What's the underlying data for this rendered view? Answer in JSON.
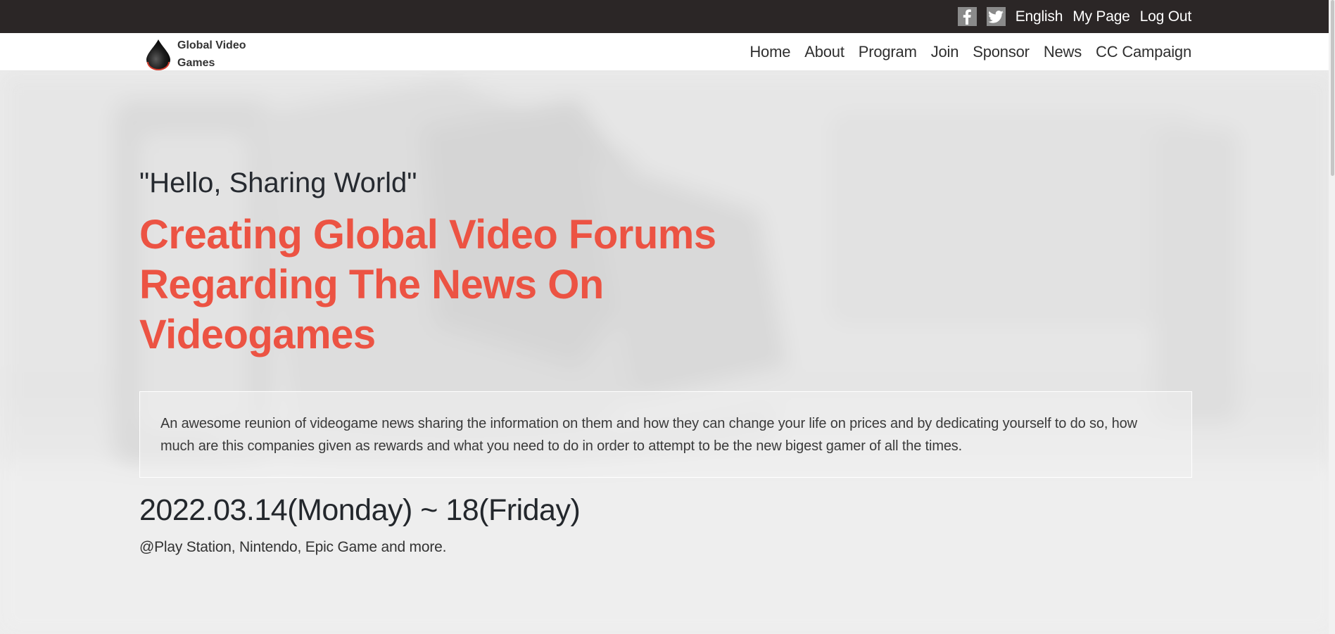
{
  "topbar": {
    "icons": [
      "facebook-icon",
      "twitter-icon"
    ],
    "language": "English",
    "my_page": "My Page",
    "logout": "Log Out"
  },
  "nav": {
    "logo_line1": "Global Video",
    "logo_line2": "Games",
    "links": [
      "Home",
      "About",
      "Program",
      "Join",
      "Sponsor",
      "News",
      "CC Campaign"
    ]
  },
  "hero": {
    "tagline": "\"Hello, Sharing World\"",
    "headline_line1": "Creating Global Video Forums",
    "headline_line2": "Regarding The News On",
    "headline_line3": "Videogames",
    "description": "An awesome reunion of videogame news sharing the information on them and how they can change your life on prices and by dedicating yourself to do so, how much are this companies given as rewards and what you need to do in order to attempt to be the new bigest gamer of all the times.",
    "date": "2022.03.14(Monday) ~ 18(Friday)",
    "venue": "@Play Station, Nintendo, Epic Game and more."
  },
  "colors": {
    "topbar_bg": "#2b2626",
    "accent": "#ec5343",
    "text_dark": "#262a30"
  }
}
